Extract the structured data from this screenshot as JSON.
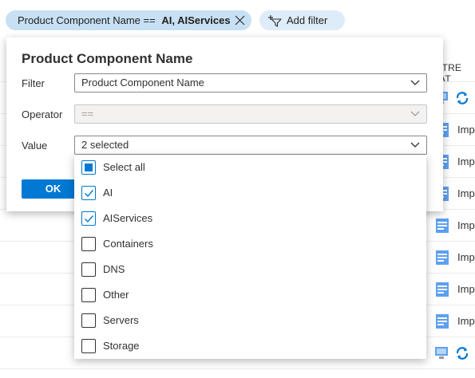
{
  "filter_pills": {
    "active": {
      "name": "Product Component Name == ",
      "value": "AI, AIServices"
    },
    "add_label": "Add filter"
  },
  "background": {
    "column_header": "ITRE AT",
    "row_label": "Imp"
  },
  "dialog": {
    "title": "Product Component Name",
    "filter_label": "Filter",
    "filter_value": "Product Component Name",
    "operator_label": "Operator",
    "operator_value": "==",
    "value_label": "Value",
    "value_summary": "2 selected",
    "ok_label": "OK"
  },
  "options": [
    {
      "label": "Select all",
      "state": "partial"
    },
    {
      "label": "AI",
      "state": "checked"
    },
    {
      "label": "AIServices",
      "state": "checked"
    },
    {
      "label": "Containers",
      "state": "unchecked"
    },
    {
      "label": "DNS",
      "state": "unchecked"
    },
    {
      "label": "Other",
      "state": "unchecked"
    },
    {
      "label": "Servers",
      "state": "unchecked"
    },
    {
      "label": "Storage",
      "state": "unchecked"
    }
  ],
  "colors": {
    "accent": "#0078d4",
    "pill_active": "#c7e0f4",
    "pill_add": "#deecf9"
  }
}
